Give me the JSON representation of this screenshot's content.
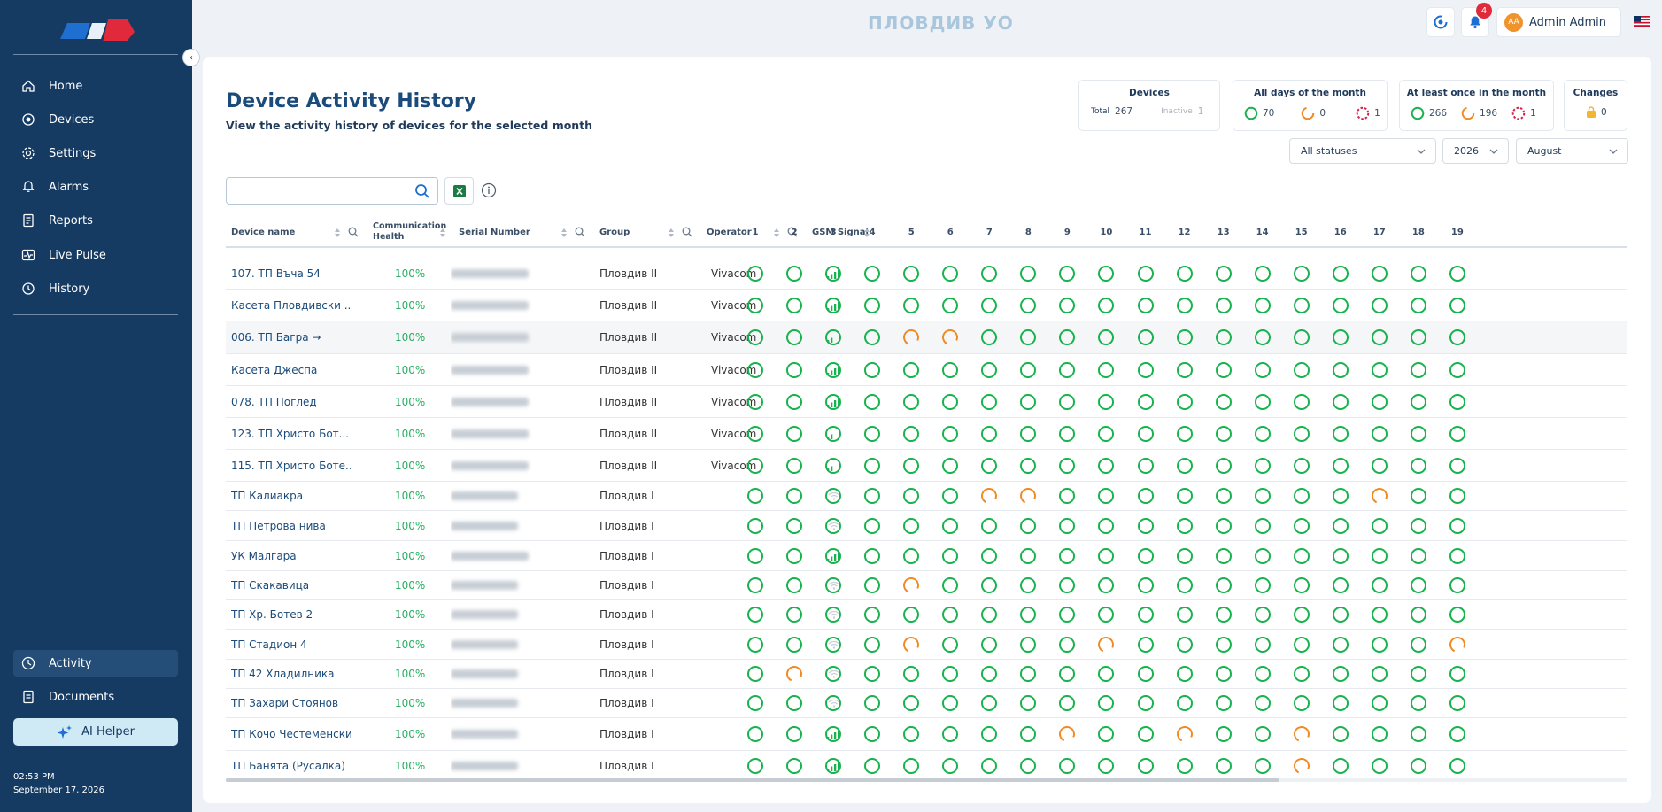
{
  "app": {
    "top_title": "ПЛОВДИВ УО",
    "notifications_count": "4",
    "user_initials": "AA",
    "user_name": "Admin Admin",
    "accent": "#153b63",
    "ok_color": "#18b34e",
    "partial_color": "#f08a24"
  },
  "sidebar": {
    "items": [
      {
        "label": "Home",
        "icon": "home-icon"
      },
      {
        "label": "Devices",
        "icon": "devices-icon"
      },
      {
        "label": "Settings",
        "icon": "gear-icon"
      },
      {
        "label": "Alarms",
        "icon": "bell-icon"
      },
      {
        "label": "Reports",
        "icon": "report-icon"
      },
      {
        "label": "Live Pulse",
        "icon": "pulse-icon"
      },
      {
        "label": "History",
        "icon": "history-icon"
      }
    ],
    "bottom_items": [
      {
        "label": "Activity",
        "icon": "activity-icon"
      },
      {
        "label": "Documents",
        "icon": "document-icon"
      }
    ],
    "ai_helper": "AI Helper",
    "time": "02:53 PM",
    "date": "September 17, 2026"
  },
  "page": {
    "title": "Device Activity History",
    "subtitle": "View the activity history of devices for the selected month"
  },
  "stats": {
    "devices": {
      "title": "Devices",
      "total_label": "Total",
      "total": "267",
      "inactive_label": "Inactive",
      "inactive": "1"
    },
    "all_days": {
      "title": "All days of the month",
      "ok": "70",
      "partial": "0",
      "none": "1"
    },
    "at_least_once": {
      "title": "At least once in the month",
      "ok": "266",
      "partial": "196",
      "none": "1"
    },
    "changes": {
      "title": "Changes",
      "value": "0"
    }
  },
  "filters": {
    "status": "All statuses",
    "year": "2026",
    "month": "August"
  },
  "table": {
    "columns": [
      "Device name",
      "Communication Health",
      "Serial Number",
      "Group",
      "Operator",
      "GSM Signal"
    ],
    "days": [
      "1",
      "2",
      "3",
      "4",
      "5",
      "6",
      "7",
      "8",
      "9",
      "10",
      "11",
      "12",
      "13",
      "14",
      "15",
      "16",
      "17",
      "18",
      "19"
    ],
    "rows": [
      {
        "name": "107. ТП Въча 54",
        "health": "100%",
        "group": "Пловдив II",
        "operator": "Vivacom",
        "gsm": "4",
        "partial": []
      },
      {
        "name": "Касета Пловдивски ...",
        "health": "100%",
        "group": "Пловдив II",
        "operator": "Vivacom",
        "gsm": "4",
        "partial": []
      },
      {
        "name": "006. ТП Багра →",
        "health": "100%",
        "group": "Пловдив II",
        "operator": "Vivacom",
        "gsm": "2",
        "partial": [
          5,
          6
        ]
      },
      {
        "name": "Касета Джеспа",
        "health": "100%",
        "group": "Пловдив II",
        "operator": "Vivacom",
        "gsm": "4",
        "partial": []
      },
      {
        "name": "078. ТП Поглед",
        "health": "100%",
        "group": "Пловдив II",
        "operator": "Vivacom",
        "gsm": "4",
        "partial": []
      },
      {
        "name": "123. ТП Христо Бот...",
        "health": "100%",
        "group": "Пловдив II",
        "operator": "Vivacom",
        "gsm": "2",
        "partial": []
      },
      {
        "name": "115. ТП Христо Боте...",
        "health": "100%",
        "group": "Пловдив II",
        "operator": "Vivacom",
        "gsm": "2",
        "partial": []
      },
      {
        "name": "ТП Калиакра",
        "health": "100%",
        "group": "Пловдив I",
        "operator": "",
        "gsm": "0",
        "partial": [
          7,
          8,
          17
        ]
      },
      {
        "name": "ТП Петрова нива",
        "health": "100%",
        "group": "Пловдив I",
        "operator": "",
        "gsm": "0",
        "partial": []
      },
      {
        "name": "УК Малгара",
        "health": "100%",
        "group": "Пловдив I",
        "operator": "",
        "gsm": "4",
        "partial": []
      },
      {
        "name": "ТП Скакавица",
        "health": "100%",
        "group": "Пловдив I",
        "operator": "",
        "gsm": "0",
        "partial": [
          5
        ]
      },
      {
        "name": "ТП Хр. Ботев 2",
        "health": "100%",
        "group": "Пловдив I",
        "operator": "",
        "gsm": "0",
        "partial": []
      },
      {
        "name": "ТП Стадион 4",
        "health": "100%",
        "group": "Пловдив I",
        "operator": "",
        "gsm": "0",
        "partial": [
          5,
          10,
          19
        ]
      },
      {
        "name": "ТП 42 Хладилника",
        "health": "100%",
        "group": "Пловдив I",
        "operator": "",
        "gsm": "0",
        "partial": [
          2
        ]
      },
      {
        "name": "ТП Захари Стоянов",
        "health": "100%",
        "group": "Пловдив I",
        "operator": "",
        "gsm": "0",
        "partial": []
      },
      {
        "name": "ТП Кочо Честеменски",
        "health": "100%",
        "group": "Пловдив I",
        "operator": "",
        "gsm": "4",
        "partial": [
          9,
          12,
          15
        ]
      },
      {
        "name": "ТП Банята (Русалка)",
        "health": "100%",
        "group": "Пловдив I",
        "operator": "",
        "gsm": "4",
        "partial": [
          15
        ]
      }
    ]
  }
}
